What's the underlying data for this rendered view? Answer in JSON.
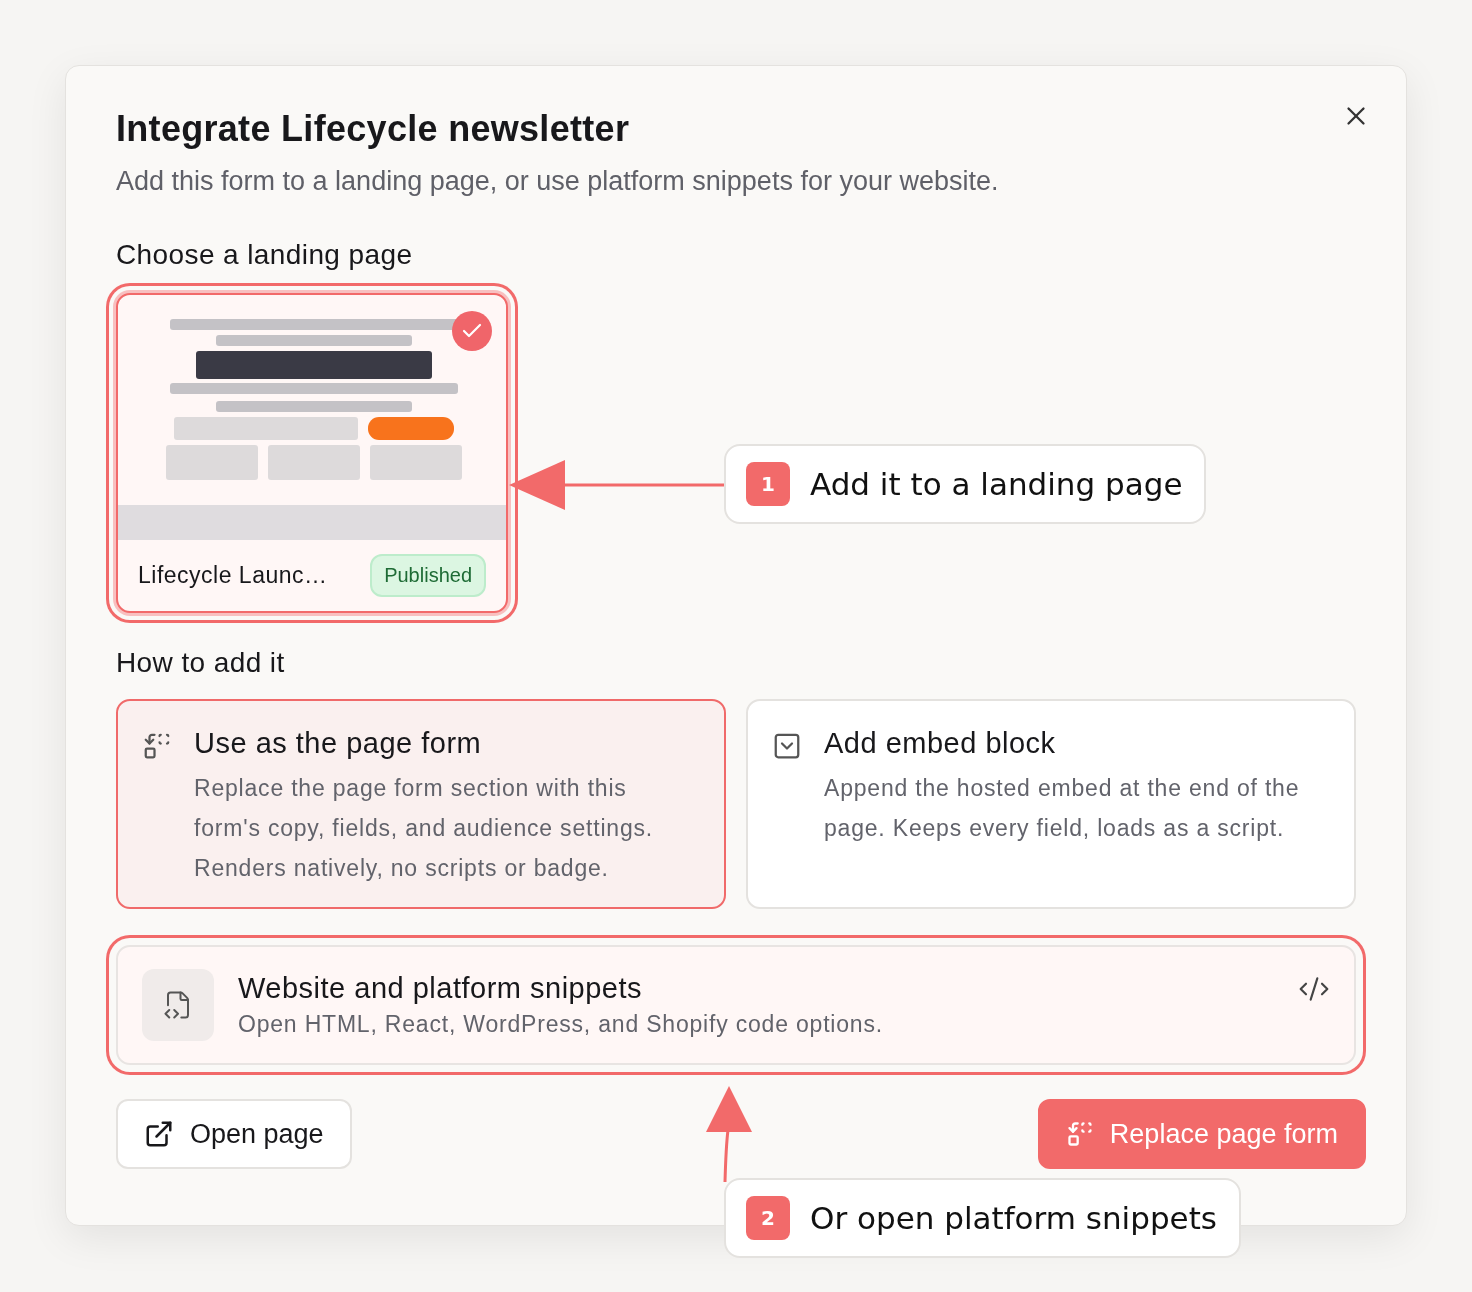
{
  "dialog": {
    "title": "Integrate Lifecycle newsletter",
    "subtitle": "Add this form to a landing page, or use platform snippets for your website."
  },
  "landing_section": {
    "heading": "Choose a landing page",
    "pages": [
      {
        "name": "Lifecycle Launc…",
        "status": "Published",
        "selected": true
      }
    ]
  },
  "method_section": {
    "heading": "How to add it",
    "methods": [
      {
        "kind": "replace",
        "title": "Use as the page form",
        "description": "Replace the page form section with this form's copy, fields, and audience settings. Renders natively, no scripts or badge.",
        "selected": true
      },
      {
        "kind": "embed",
        "title": "Add embed block",
        "description": "Append the hosted embed at the end of the page. Keeps every field, loads as a script.",
        "selected": false
      }
    ]
  },
  "snippets": {
    "title": "Website and platform snippets",
    "description": "Open HTML, React, WordPress, and Shopify code options."
  },
  "actions": [
    {
      "kind": "secondary",
      "label": "Open page"
    },
    {
      "kind": "primary",
      "label": "Replace page form"
    }
  ],
  "annotations": [
    {
      "number": "1",
      "text": "Add it to a landing page"
    },
    {
      "number": "2",
      "text": "Or open platform snippets"
    }
  ]
}
